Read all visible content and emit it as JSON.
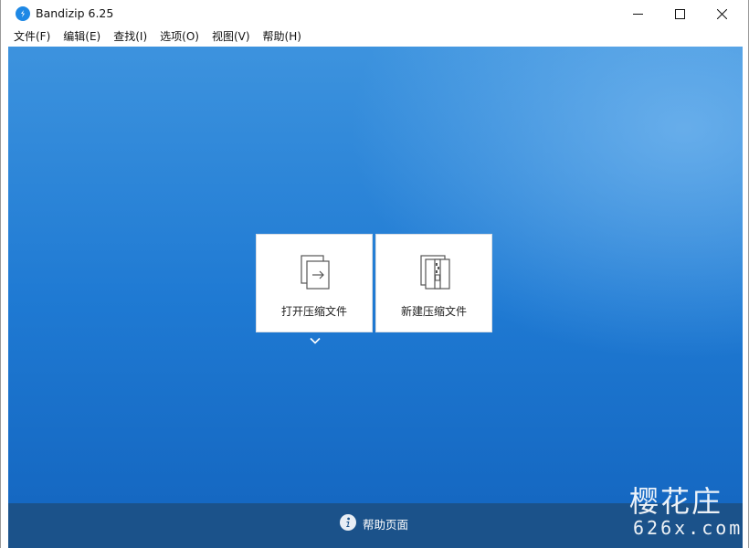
{
  "window": {
    "title": "Bandizip 6.25",
    "app_icon": "bandizip-logo-icon",
    "controls": [
      "minimize-icon",
      "maximize-icon",
      "close-icon"
    ]
  },
  "menu": {
    "items": [
      {
        "label": "文件(F)"
      },
      {
        "label": "编辑(E)"
      },
      {
        "label": "查找(I)"
      },
      {
        "label": "选项(O)"
      },
      {
        "label": "视图(V)"
      },
      {
        "label": "帮助(H)"
      }
    ]
  },
  "main": {
    "tiles": [
      {
        "label": "打开压缩文件",
        "icon": "open-archive-icon"
      },
      {
        "label": "新建压缩文件",
        "icon": "new-archive-icon"
      }
    ],
    "dropdown_icon": "chevron-down-icon"
  },
  "footer": {
    "help_label": "帮助页面",
    "help_icon": "info-icon"
  },
  "watermark": {
    "text": "樱花庄",
    "url": "626x.com"
  },
  "colors": {
    "background_top": "#3d93de",
    "background_bottom": "#1568c2",
    "footer": "#1b528a",
    "tile": "#ffffff"
  }
}
